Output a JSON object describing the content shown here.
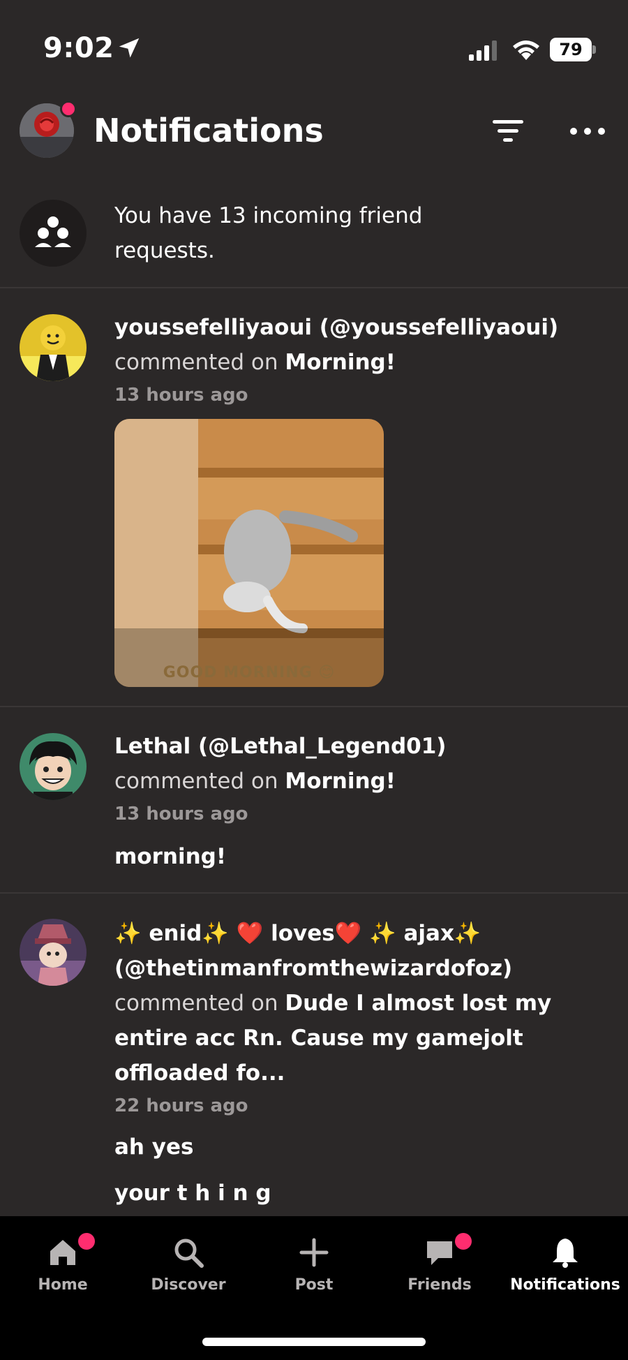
{
  "status_bar": {
    "time": "9:02",
    "battery": "79"
  },
  "header": {
    "title": "Notifications"
  },
  "friend_requests": {
    "text": "You have 13 incoming friend requests."
  },
  "notifications": [
    {
      "user": "youssefelliyaoui (@youssefelliyaoui)",
      "action": "commented on",
      "target": "Morning!",
      "time": "13 hours ago",
      "gif_caption": "GOOD MORNING 😊"
    },
    {
      "user": "Lethal (@Lethal_Legend01)",
      "action": "commented on",
      "target": "Morning!",
      "time": "13 hours ago",
      "comment": "morning!"
    },
    {
      "user": "✨ enid✨  ❤️ loves❤️  ✨ ajax✨",
      "handle": "(@thetinmanfromthewizardofoz)",
      "action": "commented on",
      "target": "Dude I almost lost my entire acc Rn. Cause my gamejolt offloaded fo...",
      "time": "22 hours ago",
      "comment": "ah yes",
      "comment2": "your t h i n g"
    }
  ],
  "tabs": [
    {
      "label": "Home"
    },
    {
      "label": "Discover"
    },
    {
      "label": "Post"
    },
    {
      "label": "Friends"
    },
    {
      "label": "Notifications"
    }
  ],
  "colors": {
    "background": "#2b2828",
    "accent_dot": "#ff2d6f",
    "tabbar": "#000000"
  }
}
